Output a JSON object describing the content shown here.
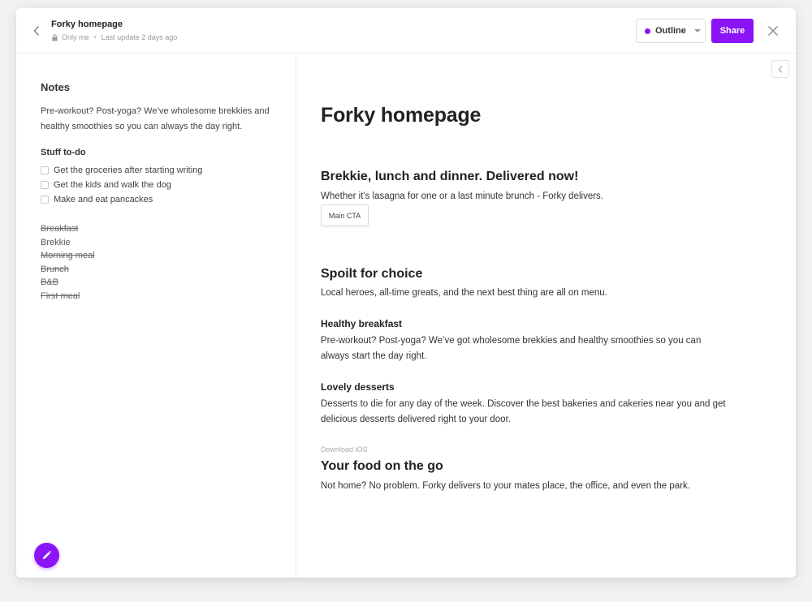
{
  "header": {
    "title": "Forky homepage",
    "visibility": "Only me",
    "last_update": "Last update 2 days ago",
    "outline_label": "Outline",
    "share_label": "Share"
  },
  "notes": {
    "heading": "Notes",
    "intro": "Pre-workout? Post-yoga? We’ve wholesome brekkies and healthy smoothies so you can always the day right.",
    "todo_heading": "Stuff to-do",
    "todos": [
      {
        "label": "Get the groceries after starting writing",
        "checked": false
      },
      {
        "label": "Get the kids and walk the dog",
        "checked": false
      },
      {
        "label": "Make and eat pancackes",
        "checked": false
      }
    ],
    "names": [
      {
        "label": "Breakfast",
        "struck": true
      },
      {
        "label": "Brekkie",
        "struck": false
      },
      {
        "label": "Morning meal",
        "struck": true
      },
      {
        "label": "Brunch",
        "struck": true
      },
      {
        "label": "B&B",
        "struck": true
      },
      {
        "label": "First meal",
        "struck": true
      }
    ]
  },
  "document": {
    "title": "Forky homepage",
    "hero_heading": "Brekkie, lunch and dinner. Delivered now!",
    "hero_text": "Whether it's lasagna for one or a last minute brunch - Forky delivers.",
    "cta_label": "Main CTA",
    "choice_heading": "Spoilt for choice",
    "choice_text": "Local heroes, all-time greats, and the next best thing are all on menu.",
    "breakfast_heading": "Healthy breakfast",
    "breakfast_text": "Pre-workout? Post-yoga? We’ve got wholesome brekkies and healthy smoothies so you can always start the day right.",
    "desserts_heading": "Lovely desserts",
    "desserts_text": "Desserts to die for any day of the week. Discover the best bakeries and cakeries near you and get delicious desserts delivered right to your door.",
    "download_label": "Download iOS",
    "go_heading": "Your food on the go",
    "go_text": "Not home? No problem. Forky delivers to your mates place, the office, and even the park."
  },
  "colors": {
    "accent": "#8a14f5",
    "background": "#f2f2f3"
  }
}
